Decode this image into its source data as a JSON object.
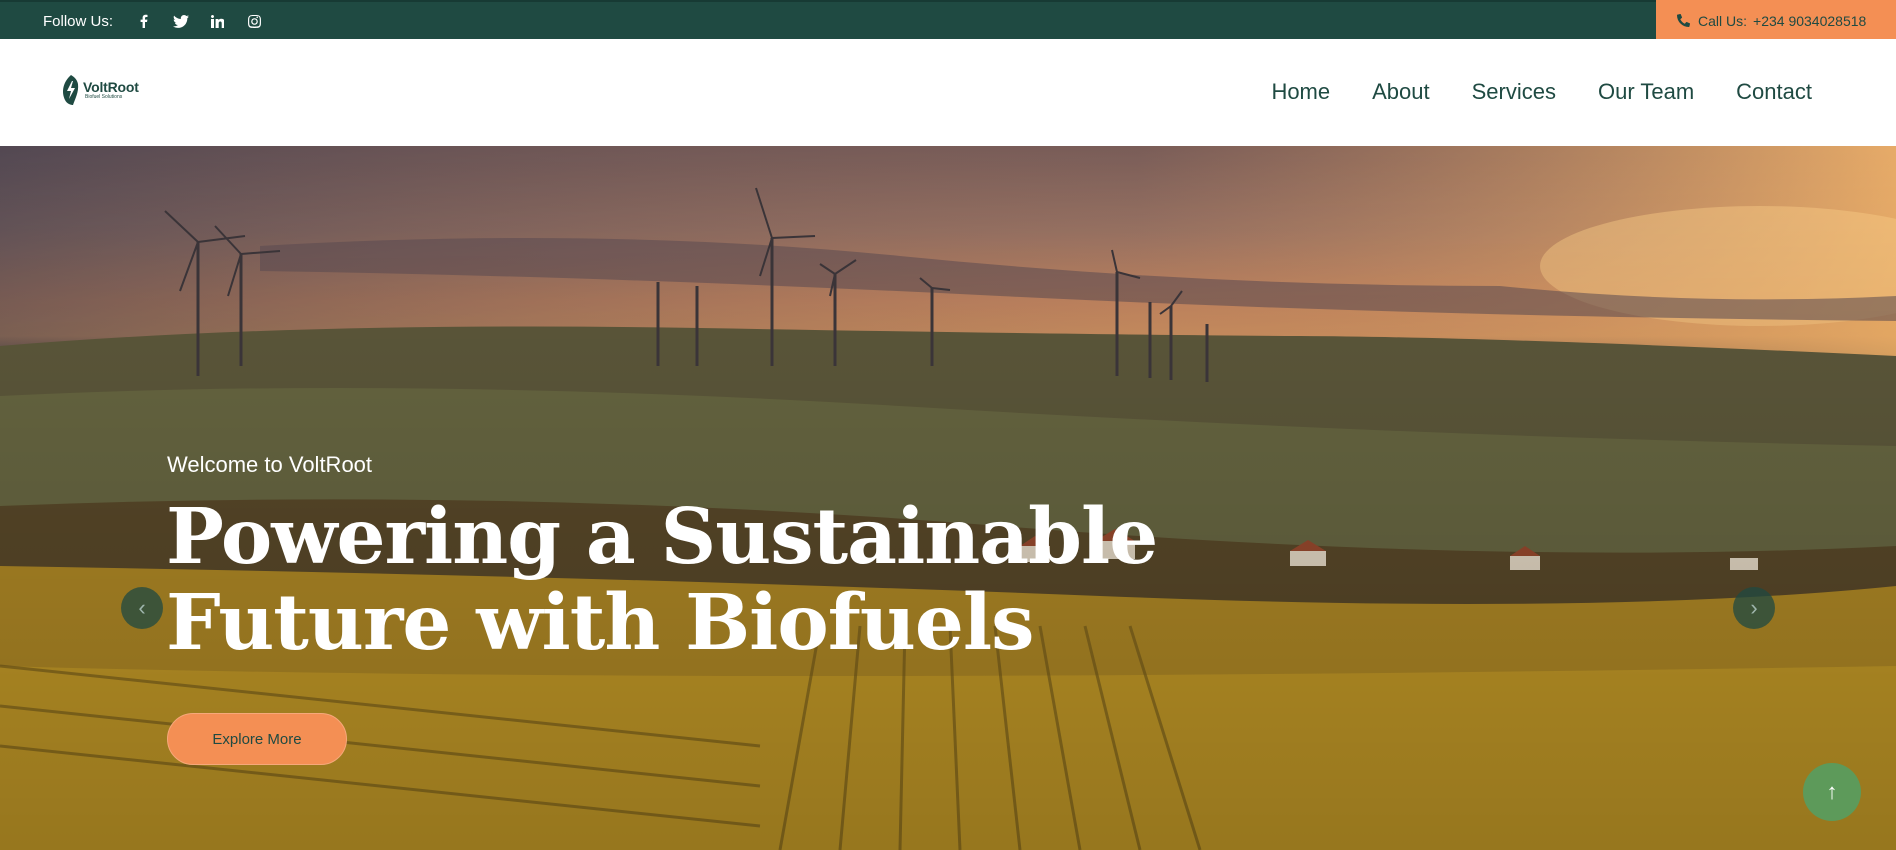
{
  "topbar": {
    "follow_label": "Follow Us:",
    "social": [
      {
        "icon": "facebook-icon"
      },
      {
        "icon": "twitter-icon"
      },
      {
        "icon": "linkedin-icon"
      },
      {
        "icon": "instagram-icon"
      }
    ],
    "call_label": "Call Us:",
    "phone": "+234 9034028518"
  },
  "header": {
    "logo_name": "VoltRoot",
    "logo_sub": "Biofuel Solutions",
    "nav": [
      "Home",
      "About",
      "Services",
      "Our Team",
      "Contact"
    ]
  },
  "hero": {
    "welcome": "Welcome to VoltRoot",
    "headline_line1": "Powering a Sustainable",
    "headline_line2": "Future with Biofuels",
    "cta": "Explore More"
  },
  "colors": {
    "brand_dark": "#1f4a42",
    "accent_orange": "#f48f54",
    "scroll_green": "#5d9a5a"
  }
}
